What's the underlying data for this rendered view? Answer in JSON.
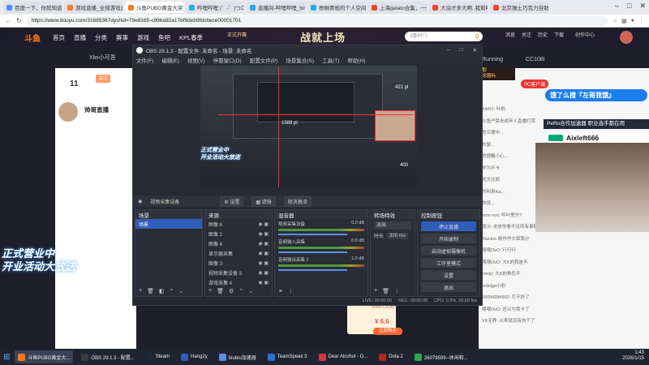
{
  "browser": {
    "tabs": [
      {
        "label": "百度一下，你就知道"
      },
      {
        "label": "游戏直播_全部游戏直播"
      },
      {
        "label": "斗鱼PUBG黄金大奖赛_j..."
      },
      {
        "label": "哔哩哔哩 (゜-゜)つロ 干杯"
      },
      {
        "label": "直播间-哔哩哔哩_bilibili"
      },
      {
        "label": "梧桐青栀的个人空间-哔"
      },
      {
        "label": "上海gelato合集，一天吃"
      },
      {
        "label": "大溢才多大啊..我和明白"
      },
      {
        "label": "北京操土巧克力自助.."
      }
    ],
    "url": "https://www.douyu.com/31685367dyshid=79e8165-c996a92a17bf9deb9fdc6ece00001701"
  },
  "site": {
    "logo": "斗鱼",
    "nav": [
      "首页",
      "直播",
      "分类",
      "赛事",
      "游戏",
      "鱼吧",
      "KPL春季"
    ],
    "banner": "战就上场",
    "search_placeholder": "3番村门",
    "header_icons": [
      "消息",
      "关注",
      "历史",
      "下载",
      "创作中心"
    ],
    "center_badge": "正式开赛",
    "xwe_label": "Xlei小可吾",
    "running_label": "Running",
    "cc_label": "CC108i",
    "room_number": "11",
    "streamer": "帅哥直播",
    "follow_label": "关注",
    "left_promo": [
      "正式营业中",
      "开业活动大放送"
    ],
    "coin_amount": "¥ 6.6",
    "coin_btn": "立即购买",
    "coin_name": "1000-COIN",
    "pc_tag": "PC客户端",
    "promo": [
      "你可领取",
      "蛇年纪念圈标"
    ]
  },
  "chat": {
    "lines": [
      "Xlefl小 叶柄",
      "斗鱼严禁未成年人直播打赏",
      "的兰德中...",
      "约瑟...",
      "的提醒小心...",
      "华为不卡",
      "凯文比胡",
      "的利来Ka...",
      "你说...",
      "emo ovo: 呼叶里升?",
      "提示: 皮皮你看不见所有事情",
      "Blackro 新作作文章我分",
      "喂喂OvO: 行行行",
      "喂喂OvO: 大K的我是不",
      "kmdy: 大K的角色不",
      "Indulge小彩:",
      "18094284992: 打不好了",
      "喂喂OvO: 还以为我卡了",
      "VK无界: 从来就没有你干了"
    ]
  },
  "overlay": {
    "stream_pill": "饿了么搜『左哥我饿』",
    "pero_banner": "PeRo合作加速器 职业选手都在用",
    "cam_tag": "Aixleft666"
  },
  "obs": {
    "title": "OBS 29.1.3 - 配置文件: 未命名 - 场景: 未命名",
    "menu": [
      "文件(F)",
      "编辑(E)",
      "视图(V)",
      "停靠窗口(D)",
      "配置文件(P)",
      "场景集合(S)",
      "工具(T)",
      "帮助(H)"
    ],
    "toolbar": {
      "device_label": "视频采集设备",
      "settings": "设置",
      "filters": "滤镜",
      "deactivate": "取消激活"
    },
    "preview_overlay": [
      "正式营业中",
      "开业活动大放送"
    ],
    "preview_counts": [
      "421 pl",
      "1589 pl",
      "400"
    ],
    "scenes": {
      "title": "场景",
      "items": [
        "场景"
      ]
    },
    "sources": {
      "title": "来源",
      "items": [
        "图像 6",
        "图像 2",
        "图像 4",
        "显示器采集",
        "图像 3",
        "视频采集设备 3",
        "游戏采集 4"
      ]
    },
    "mixer": {
      "title": "混音器",
      "channels": [
        {
          "name": "视频采集设备",
          "db": "0.0 dB"
        },
        {
          "name": "音频输入采集",
          "db": "0.0 dB"
        },
        {
          "name": "音频输出采集 2",
          "db": "1.0 dB"
        }
      ]
    },
    "transitions": {
      "title": "转场特效",
      "type": "淡出",
      "duration_label": "时长",
      "duration": "300 ms"
    },
    "controls": {
      "title": "控制按钮",
      "buttons": [
        "停止直播",
        "开始录制",
        "启动虚拟摄像机",
        "工作室模式",
        "设置",
        "退出"
      ]
    },
    "status": {
      "live": "LIVE: 00:00:00",
      "rec": "REC: 00:00:00",
      "cpu": "CPU: 0.5%, 60.00 fps"
    }
  },
  "taskbar": {
    "items": [
      {
        "label": "斗鱼PUBG黄金大...",
        "color": "#ff7a1a"
      },
      {
        "label": "OBS 29.1.3 - 配置...",
        "color": "#3a3a3a"
      },
      {
        "label": "Steam",
        "color": "#1b2838"
      },
      {
        "label": "Hang2y",
        "color": "#2b5fb8"
      },
      {
        "label": "biubiu加速器",
        "color": "#5e8de8"
      },
      {
        "label": "TeamSpeak 3",
        "color": "#2a6fd1"
      },
      {
        "label": "Dear Alcohol - D...",
        "color": "#d13a3a"
      },
      {
        "label": "Dota 2",
        "color": "#b22a22"
      },
      {
        "label": "26079599--休闲和...",
        "color": "#2ea84e"
      }
    ],
    "time": "1:43",
    "date": "2026/1/15"
  }
}
